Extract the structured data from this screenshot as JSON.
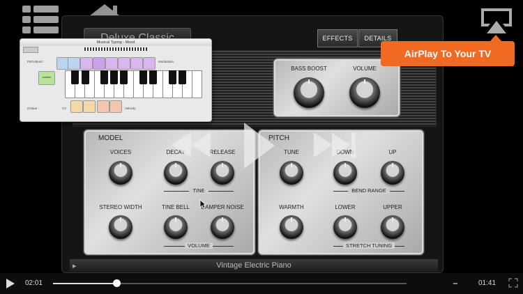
{
  "instrument": {
    "preset_name": "Deluxe Classic",
    "buttons": {
      "effects": "EFFECTS",
      "details": "DETAILS"
    },
    "top_panel": {
      "bass_boost": "BASS BOOST",
      "volume": "VOLUME"
    },
    "model_panel": {
      "title": "MODEL",
      "voices": "VOICES",
      "decay": "DECAY",
      "release": "RELEASE",
      "tine_group": "TINE",
      "stereo_width": "STEREO WIDTH",
      "tine_bell": "TINE BELL",
      "damper_noise": "DAMPER NOISE",
      "volume_group": "VOLUME"
    },
    "pitch_panel": {
      "title": "PITCH",
      "tune": "TUNE",
      "down": "DOWN",
      "up": "UP",
      "bend_group": "BEND RANGE",
      "warmth": "WARMTH",
      "lower": "LOWER",
      "upper": "UPPER",
      "stretch_group": "STRETCH TUNING"
    },
    "footer": "Vintage Electric Piano"
  },
  "musical_typing": {
    "title": "Musical Typing - Mood",
    "pitch_bend": "Pitch Bend :",
    "modulation": "Modulation",
    "sustain": "sustain",
    "octave": "Octave :",
    "octave_value": "C2",
    "velocity": "Velocity"
  },
  "overlay": {
    "airplay_badge": "AirPlay To Your TV"
  },
  "player": {
    "elapsed": "02:01",
    "remaining": "01:41",
    "progress": 0.18
  }
}
